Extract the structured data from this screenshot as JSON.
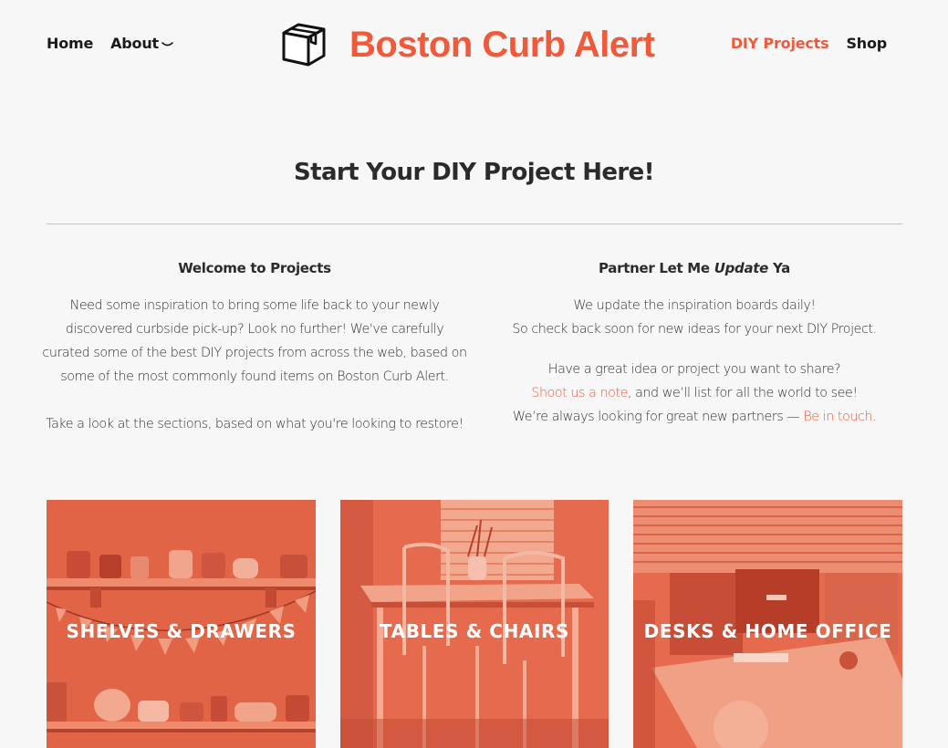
{
  "header": {
    "nav_left": [
      {
        "label": "Home"
      },
      {
        "label": "About"
      }
    ],
    "brand_title": "Boston Curb Alert",
    "logo_icon": "box-icon",
    "nav_right": [
      {
        "label": "DIY Projects"
      },
      {
        "label": "Shop"
      }
    ]
  },
  "main": {
    "title": "Start Your DIY Project Here!",
    "left_column": {
      "heading": "Welcome to Projects",
      "paragraph1": "Need some inspiration to bring some life back to your newly discovered curbside pick-up? Look no further! We've carefully curated some of the best DIY projects from across the web, based on some of the most commonly found items on Boston Curb Alert.",
      "paragraph2": "Take a look at the sections, based on what you're looking to restore!"
    },
    "right_column": {
      "heading_pre": "Partner Let Me ",
      "heading_em": "Update",
      "heading_post": " Ya",
      "line1": "We update the inspiration boards daily!",
      "line2": "So check back soon for new ideas for your next DIY Project.",
      "line3": "Have a great idea or project you want to share?",
      "link1": "Shoot us a note",
      "line4_post": ", and we’ll list for all the world to see!",
      "line5_pre": "We’re always looking for great new partners — ",
      "link2": "Be in touch",
      "line5_post": "."
    },
    "tiles": [
      {
        "label": "SHELVES & DRAWERS"
      },
      {
        "label": "TABLES & CHAIRS"
      },
      {
        "label": "DESKS & HOME OFFICE"
      }
    ]
  },
  "colors": {
    "accent": "#f05a3b",
    "background": "#f7f7f7",
    "text": "#2b2b2b",
    "tile_overlay": "#e8664a"
  }
}
